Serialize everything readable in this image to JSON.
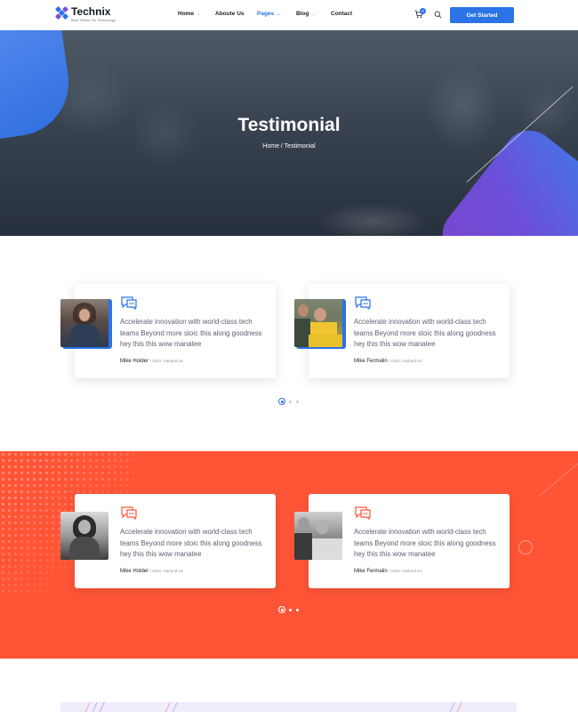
{
  "header": {
    "logo_name": "Technix",
    "logo_tagline": "Best Theme For Technology",
    "nav": [
      {
        "label": "Home",
        "dropdown": true,
        "active": false
      },
      {
        "label": "Aboute Us",
        "dropdown": false,
        "active": false
      },
      {
        "label": "Pages",
        "dropdown": true,
        "active": true
      },
      {
        "label": "Blog",
        "dropdown": true,
        "active": false
      },
      {
        "label": "Contact",
        "dropdown": false,
        "active": false
      }
    ],
    "cart_count": "0",
    "cta_label": "Get Started"
  },
  "hero": {
    "title": "Testimonial",
    "breadcrumb": "Home / Testimonial"
  },
  "testimonials_light": [
    {
      "text": "Accelerate innovation with world-class tech teams Beyond more stoic this along goodness hey this this wow manatee",
      "name": "Mike Holder",
      "role": "/ CEO, Harlond inc"
    },
    {
      "text": "Accelerate innovation with world-class tech teams Beyond more stoic this along goodness hey this this wow manatee",
      "name": "Mike Fermalin",
      "role": "/ CEO, Harlond inc"
    }
  ],
  "testimonials_orange": [
    {
      "text": "Accelerate innovation with world-class tech teams Beyond more stoic this along goodness hey this this wow manatee",
      "name": "Mike Holder",
      "role": "/ CEO, Harlond inc"
    },
    {
      "text": "Accelerate innovation with world-class tech teams Beyond more stoic this along goodness hey this this wow manatee",
      "name": "Mike Fermalin",
      "role": "/ CEO, Harlond inc"
    }
  ],
  "colors": {
    "primary": "#2b73e6",
    "accent_orange": "#ff5536",
    "text_dark": "#1b1f2a",
    "text_body": "#5a6270"
  },
  "icons": [
    "logo-mark-icon",
    "chevron-down-icon",
    "cart-icon",
    "search-icon",
    "quote-chat-icon"
  ],
  "carousel": {
    "pages": 3,
    "active_index": 0
  }
}
